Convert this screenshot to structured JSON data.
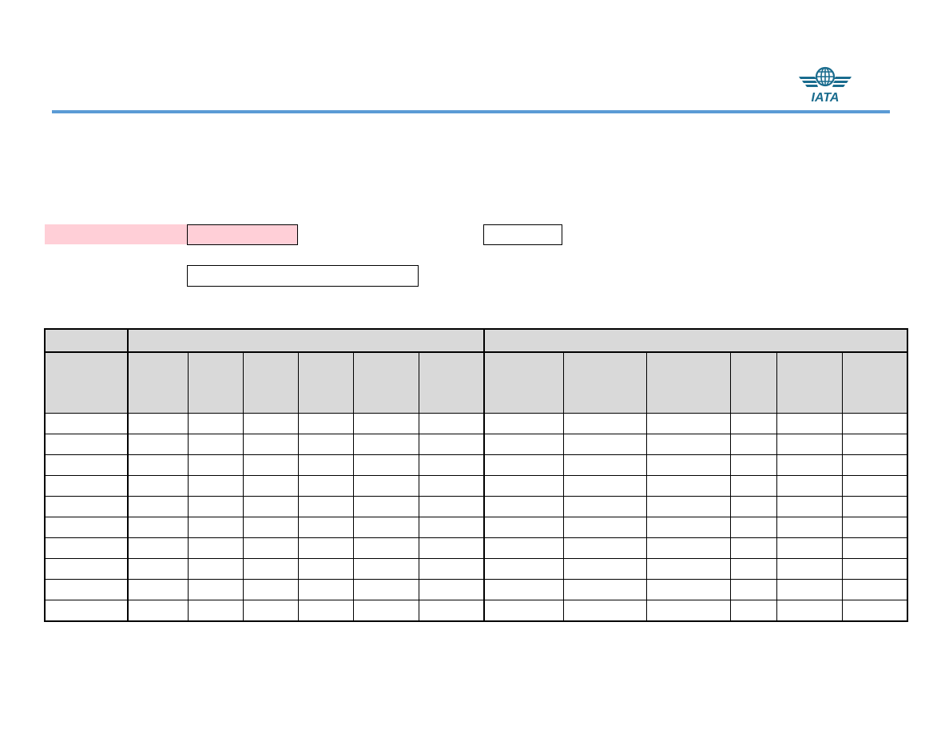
{
  "theme": {
    "rule_color": "#5b9bd5",
    "highlight_color": "#ffcfd7",
    "header_fill": "#d9d9d9"
  },
  "logo": {
    "text": "IATA",
    "icon": "iata-globe-wings-logo",
    "color": "#1a6c8e"
  },
  "form": {
    "label_1": "",
    "field_1": "",
    "field_2": "",
    "field_3": ""
  },
  "table": {
    "group_headers": [
      "",
      "",
      ""
    ],
    "column_headers": [
      "",
      "",
      "",
      "",
      "",
      "",
      "",
      "",
      "",
      "",
      "",
      "",
      ""
    ],
    "rows": [
      [
        "",
        "",
        "",
        "",
        "",
        "",
        "",
        "",
        "",
        "",
        "",
        "",
        ""
      ],
      [
        "",
        "",
        "",
        "",
        "",
        "",
        "",
        "",
        "",
        "",
        "",
        "",
        ""
      ],
      [
        "",
        "",
        "",
        "",
        "",
        "",
        "",
        "",
        "",
        "",
        "",
        "",
        ""
      ],
      [
        "",
        "",
        "",
        "",
        "",
        "",
        "",
        "",
        "",
        "",
        "",
        "",
        ""
      ],
      [
        "",
        "",
        "",
        "",
        "",
        "",
        "",
        "",
        "",
        "",
        "",
        "",
        ""
      ],
      [
        "",
        "",
        "",
        "",
        "",
        "",
        "",
        "",
        "",
        "",
        "",
        "",
        ""
      ],
      [
        "",
        "",
        "",
        "",
        "",
        "",
        "",
        "",
        "",
        "",
        "",
        "",
        ""
      ],
      [
        "",
        "",
        "",
        "",
        "",
        "",
        "",
        "",
        "",
        "",
        "",
        "",
        ""
      ],
      [
        "",
        "",
        "",
        "",
        "",
        "",
        "",
        "",
        "",
        "",
        "",
        "",
        ""
      ],
      [
        "",
        "",
        "",
        "",
        "",
        "",
        "",
        "",
        "",
        "",
        "",
        "",
        ""
      ]
    ]
  }
}
